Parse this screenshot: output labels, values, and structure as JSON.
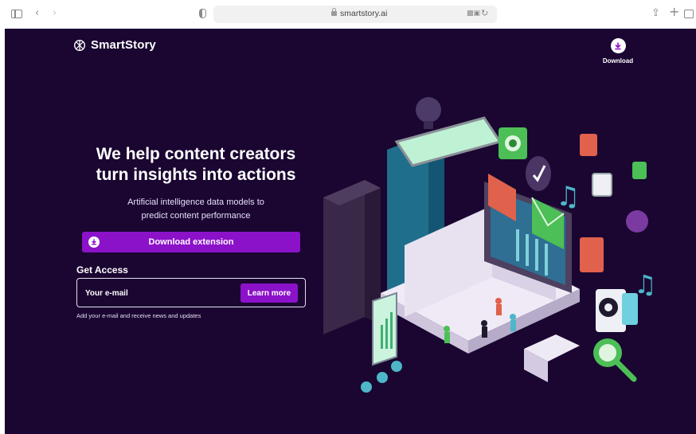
{
  "browser": {
    "url": "smartstory.ai"
  },
  "header": {
    "brand": "SmartStory",
    "download_label": "Download"
  },
  "hero": {
    "headline_line1": "We help content creators",
    "headline_line2": "turn insights into actions",
    "sub_line1": "Artificial intelligence data models to",
    "sub_line2": "predict content performance",
    "cta_label": "Download extension"
  },
  "access": {
    "title": "Get Access",
    "email_placeholder": "Your e-mail",
    "button_label": "Learn more",
    "helper": "Add your e-mail and receive news and updates"
  },
  "colors": {
    "background": "#1a0631",
    "accent": "#8b12c9",
    "text": "#ffffff"
  }
}
